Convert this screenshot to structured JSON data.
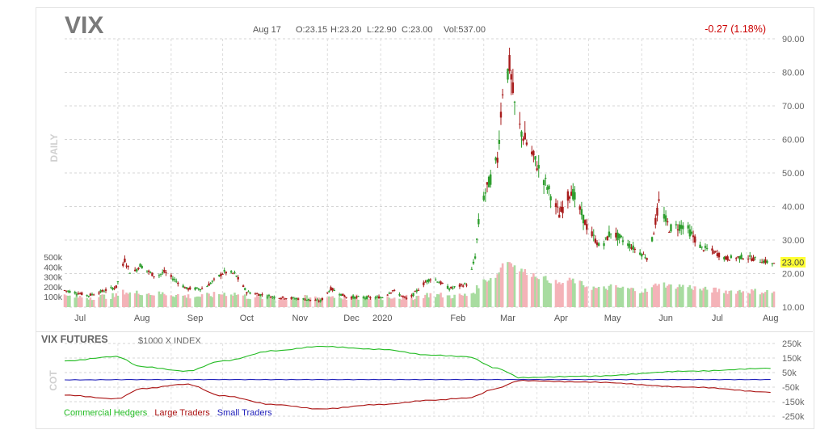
{
  "header": {
    "symbol": "VIX",
    "date": "Aug 17",
    "open_label": "O:23.15",
    "high_label": "H:23.20",
    "low_label": "L:22.90",
    "close_label": "C:23.00",
    "volume_label": "Vol:537.00",
    "change_label": "-0.27 (1.18%)",
    "last_price_label": "23.00"
  },
  "colors": {
    "up_candle": "#2e9e2e",
    "down_candle": "#a81c1c",
    "volume_up": "#a8dca0",
    "volume_down": "#f4b3b8",
    "change_text": "#cc0000",
    "last_price_bg": "#ffff33",
    "commercial": "#22bb22",
    "large": "#aa1111",
    "small": "#2222bb"
  },
  "chart_data": [
    {
      "type": "candlestick",
      "period_label": "DAILY",
      "x_tick_labels": [
        "Jul",
        "Aug",
        "Sep",
        "Oct",
        "Nov",
        "Dec",
        "2020",
        "Feb",
        "Mar",
        "Apr",
        "May",
        "Jun",
        "Jul",
        "Aug"
      ],
      "y_tick_labels": [
        "90.00",
        "80.00",
        "70.00",
        "60.00",
        "50.00",
        "40.00",
        "30.00",
        "20.00",
        "10.00"
      ],
      "ylim": [
        10,
        90
      ],
      "volume_tick_labels": [
        "500k",
        "400k",
        "300k",
        "200k",
        "100k"
      ],
      "grid": true,
      "last_close": 23.0,
      "anchors": [
        {
          "date": "Jul 1",
          "close": 15.0
        },
        {
          "date": "Jul 15",
          "close": 13.5
        },
        {
          "date": "Jul 31",
          "close": 16.0
        },
        {
          "date": "Aug 5",
          "close": 24.0
        },
        {
          "date": "Aug 9",
          "close": 19.5
        },
        {
          "date": "Aug 14",
          "close": 22.5
        },
        {
          "date": "Aug 23",
          "close": 19.0
        },
        {
          "date": "Aug 28",
          "close": 20.5
        },
        {
          "date": "Sep 10",
          "close": 15.5
        },
        {
          "date": "Sep 20",
          "close": 15.5
        },
        {
          "date": "Oct 2",
          "close": 20.5
        },
        {
          "date": "Oct 8",
          "close": 20.0
        },
        {
          "date": "Oct 15",
          "close": 14.5
        },
        {
          "date": "Oct 31",
          "close": 13.0
        },
        {
          "date": "Nov 15",
          "close": 12.5
        },
        {
          "date": "Nov 27",
          "close": 11.8
        },
        {
          "date": "Dec 3",
          "close": 15.5
        },
        {
          "date": "Dec 12",
          "close": 13.0
        },
        {
          "date": "Dec 26",
          "close": 12.8
        },
        {
          "date": "Jan 2",
          "close": 13.0
        },
        {
          "date": "Jan 8",
          "close": 15.0
        },
        {
          "date": "Jan 17",
          "close": 12.2
        },
        {
          "date": "Jan 27",
          "close": 17.5
        },
        {
          "date": "Jan 31",
          "close": 18.8
        },
        {
          "date": "Feb 10",
          "close": 15.5
        },
        {
          "date": "Feb 21",
          "close": 17.0
        },
        {
          "date": "Feb 25",
          "close": 25.0
        },
        {
          "date": "Feb 28",
          "close": 40.0
        },
        {
          "date": "Mar 9",
          "close": 54.0
        },
        {
          "date": "Mar 12",
          "close": 75.0
        },
        {
          "date": "Mar 16",
          "close": 82.0
        },
        {
          "date": "Mar 20",
          "close": 66.0
        },
        {
          "date": "Mar 24",
          "close": 61.0
        },
        {
          "date": "Mar 31",
          "close": 53.5
        },
        {
          "date": "Apr 7",
          "close": 46.0
        },
        {
          "date": "Apr 14",
          "close": 37.5
        },
        {
          "date": "Apr 21",
          "close": 45.0
        },
        {
          "date": "Apr 30",
          "close": 34.0
        },
        {
          "date": "May 8",
          "close": 27.5
        },
        {
          "date": "May 14",
          "close": 32.5
        },
        {
          "date": "May 26",
          "close": 28.0
        },
        {
          "date": "Jun 5",
          "close": 24.5
        },
        {
          "date": "Jun 11",
          "close": 41.0
        },
        {
          "date": "Jun 17",
          "close": 33.5
        },
        {
          "date": "Jun 26",
          "close": 34.5
        },
        {
          "date": "Jul 6",
          "close": 27.5
        },
        {
          "date": "Jul 10",
          "close": 27.3
        },
        {
          "date": "Jul 20",
          "close": 24.5
        },
        {
          "date": "Jul 31",
          "close": 25.0
        },
        {
          "date": "Aug 17",
          "close": 23.0
        }
      ]
    },
    {
      "type": "line",
      "title": "VIX FUTURES",
      "subtitle": "$1000 X INDEX",
      "side_label": "COT",
      "y_tick_labels": [
        "250k",
        "150k",
        "50k",
        "-50k",
        "-150k",
        "-250k"
      ],
      "ylim": [
        -250000,
        250000
      ],
      "legend_position": "bottom-left",
      "series": [
        {
          "name": "Commercial Hedgers",
          "points": [
            {
              "date": "Jul 1",
              "value": 130000
            },
            {
              "date": "Jul 31",
              "value": 160000
            },
            {
              "date": "Aug 15",
              "value": 90000
            },
            {
              "date": "Sep 10",
              "value": 60000
            },
            {
              "date": "Oct 1",
              "value": 130000
            },
            {
              "date": "Oct 31",
              "value": 200000
            },
            {
              "date": "Nov 27",
              "value": 230000
            },
            {
              "date": "Dec 31",
              "value": 210000
            },
            {
              "date": "Jan 31",
              "value": 170000
            },
            {
              "date": "Feb 20",
              "value": 160000
            },
            {
              "date": "Mar 9",
              "value": 80000
            },
            {
              "date": "Mar 16",
              "value": 50000
            },
            {
              "date": "Mar 20",
              "value": 15000
            },
            {
              "date": "Apr 30",
              "value": 25000
            },
            {
              "date": "Jun 30",
              "value": 60000
            },
            {
              "date": "Aug 17",
              "value": 80000
            }
          ]
        },
        {
          "name": "Large Traders",
          "points": [
            {
              "date": "Jul 1",
              "value": -105000
            },
            {
              "date": "Jul 31",
              "value": -130000
            },
            {
              "date": "Aug 15",
              "value": -60000
            },
            {
              "date": "Sep 10",
              "value": -30000
            },
            {
              "date": "Oct 1",
              "value": -110000
            },
            {
              "date": "Oct 31",
              "value": -170000
            },
            {
              "date": "Nov 27",
              "value": -200000
            },
            {
              "date": "Dec 31",
              "value": -170000
            },
            {
              "date": "Jan 31",
              "value": -140000
            },
            {
              "date": "Feb 20",
              "value": -125000
            },
            {
              "date": "Mar 9",
              "value": -60000
            },
            {
              "date": "Mar 16",
              "value": -30000
            },
            {
              "date": "Mar 20",
              "value": -5000
            },
            {
              "date": "Apr 30",
              "value": -15000
            },
            {
              "date": "Jun 30",
              "value": -50000
            },
            {
              "date": "Aug 17",
              "value": -85000
            }
          ]
        },
        {
          "name": "Small Traders",
          "points": [
            {
              "date": "Jul 1",
              "value": 0
            },
            {
              "date": "Aug 17",
              "value": 2000
            }
          ]
        }
      ]
    }
  ]
}
